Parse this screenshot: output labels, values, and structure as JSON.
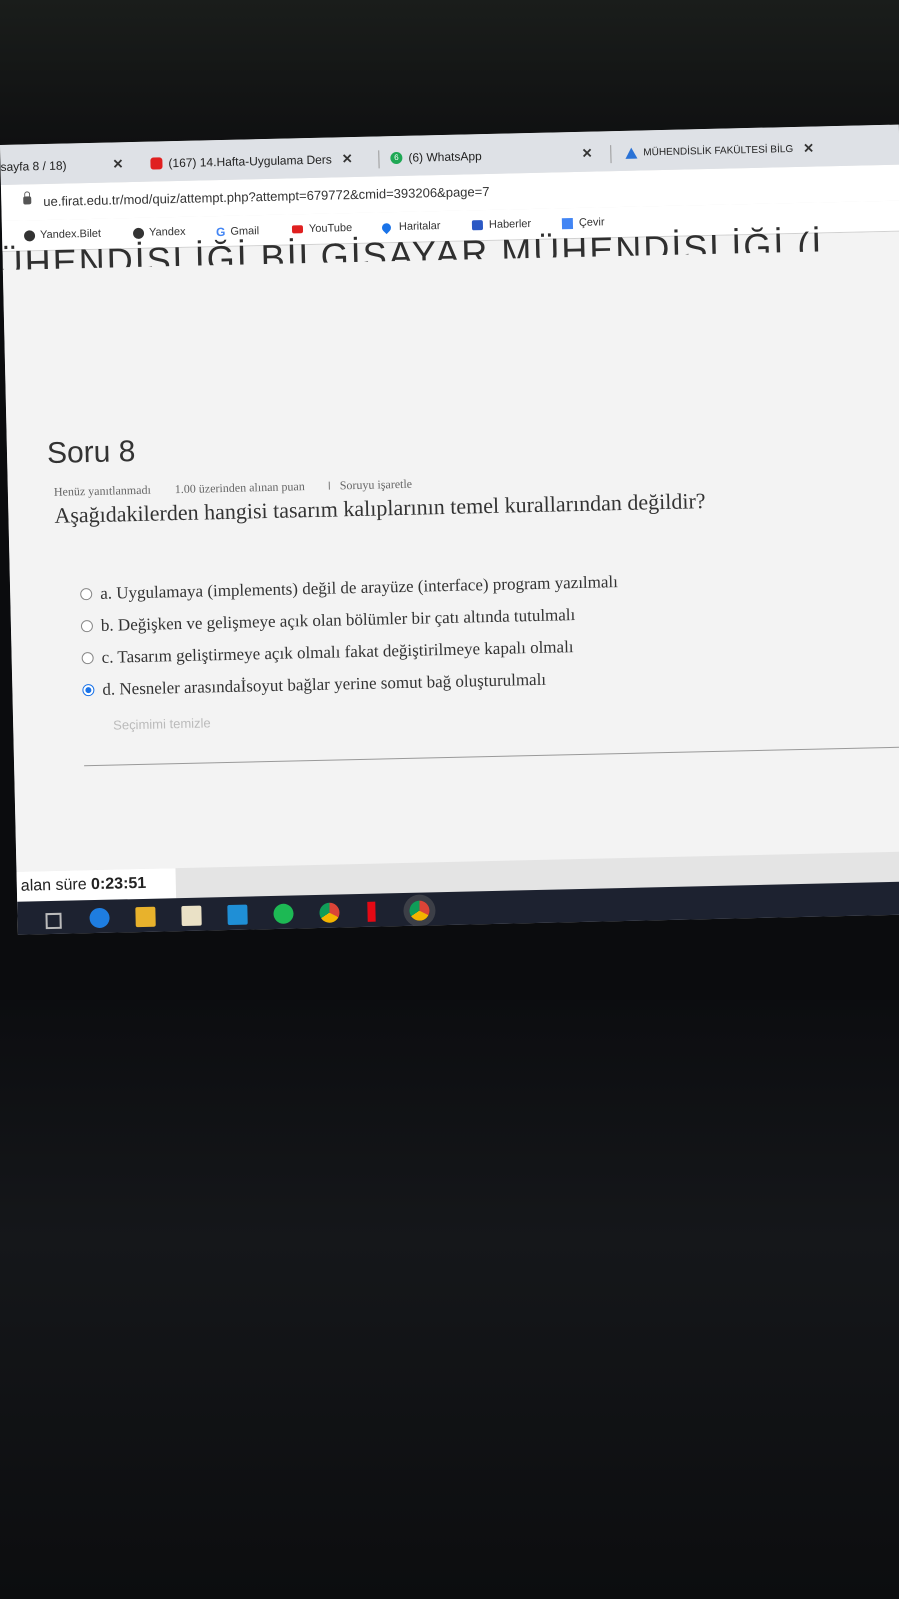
{
  "browser": {
    "tabs": [
      {
        "label": "sayfa 8 / 18)",
        "close": "✕"
      },
      {
        "label": "(167) 14.Hafta-Uygulama Ders",
        "close": "✕",
        "icon": "youtube-icon"
      },
      {
        "label": "(6) WhatsApp",
        "close": "✕",
        "icon": "whatsapp-icon",
        "badge": "6"
      },
      {
        "label": "MÜHENDİSLİK FAKÜLTESİ BİLG",
        "close": "✕",
        "icon": "drive-icon"
      }
    ],
    "url": "ue.firat.edu.tr/mod/quiz/attempt.php?attempt=679772&cmid=393206&page=7",
    "bookmarks": [
      "Yandex.Bilet",
      "Yandex",
      "Gmail",
      "YouTube",
      "Haritalar",
      "Haberler",
      "Çevir"
    ]
  },
  "page": {
    "banner": "ÜHENDİSLİĞİ BİLGİSAYAR MÜHENDİSLİĞİ (İ",
    "question_number": "Soru 8",
    "status": "Henüz yanıtlanmadı",
    "points": "1.00 üzerinden alınan puan",
    "flag_label": "Soruyu işaretle",
    "question_text": "Aşağıdakilerden hangisi tasarım kalıplarının temel kurallarından değildir?",
    "options": [
      {
        "label": "a. Uygulamaya (implements) değil de arayüze (interface) program yazılmalı",
        "selected": false
      },
      {
        "label": "b. Değişken ve gelişmeye açık olan bölümler bir çatı altında tutulmalı",
        "selected": false
      },
      {
        "label": "c. Tasarım geliştirmeye açık olmalı fakat değiştirilmeye kapalı olmalı",
        "selected": false
      },
      {
        "label": "d. Nesneler arasındaİsoyut bağlar yerine somut bağ oluşturulmalı",
        "selected": true
      }
    ],
    "clear_choice": "Seçimimi temizle"
  },
  "timer": {
    "label": "alan süre",
    "value": "0:23:51"
  },
  "colors": {
    "accent": "#1a73e8",
    "taskbar": "#1d2230"
  }
}
